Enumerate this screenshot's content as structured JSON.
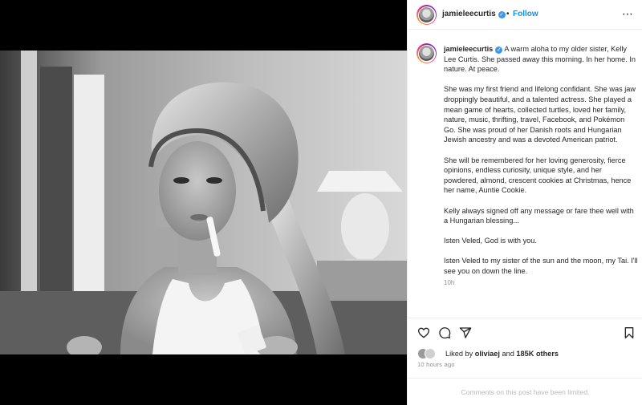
{
  "header": {
    "username": "jamieleecurtis",
    "separator": "•",
    "follow_label": "Follow",
    "more_label": "⋯",
    "verified_icon": "✓"
  },
  "caption": {
    "username": "jamieleecurtis",
    "verified_icon": "✓",
    "paragraphs": [
      "A warm aloha to my older sister, Kelly Lee Curtis. She passed away this morning. In her home. In nature. At peace.",
      "She was my first friend and lifelong confidant. She was jaw droppingly beautiful, and a talented actress. She played a mean game of hearts, collected turtles, loved her family, nature, music, thrifting, travel, Facebook, and Pokémon Go. She was proud of her Danish roots and Hungarian Jewish ancestry and was a devoted American patriot.",
      "She will be remembered for her loving generosity, fierce opinions, endless curiosity, unique style, and her powdered, almond, crescent cookies at Christmas, hence her name, Auntie Cookie.",
      "Kelly always signed off any message or fare thee well with a Hungarian blessing...",
      "Isten Veled, God is with you.",
      "Isten Veled to my sister of the sun and the moon, my Tai. I'll see you on down the line."
    ],
    "relative_time": "10h"
  },
  "actions": {
    "icons": [
      "heart-icon",
      "comment-icon",
      "share-icon",
      "bookmark-icon"
    ],
    "liked_by_prefix": "Liked by",
    "liked_by_user": "oliviaej",
    "and_label": "and",
    "likes_count": "185K others",
    "post_time": "10 hours ago"
  },
  "comments": {
    "limited_text": "Comments on this post have been limited."
  },
  "colors": {
    "follow": "#0095f6",
    "verified": "#3897f0",
    "muted": "#8e8e8e",
    "border": "#efefef"
  }
}
